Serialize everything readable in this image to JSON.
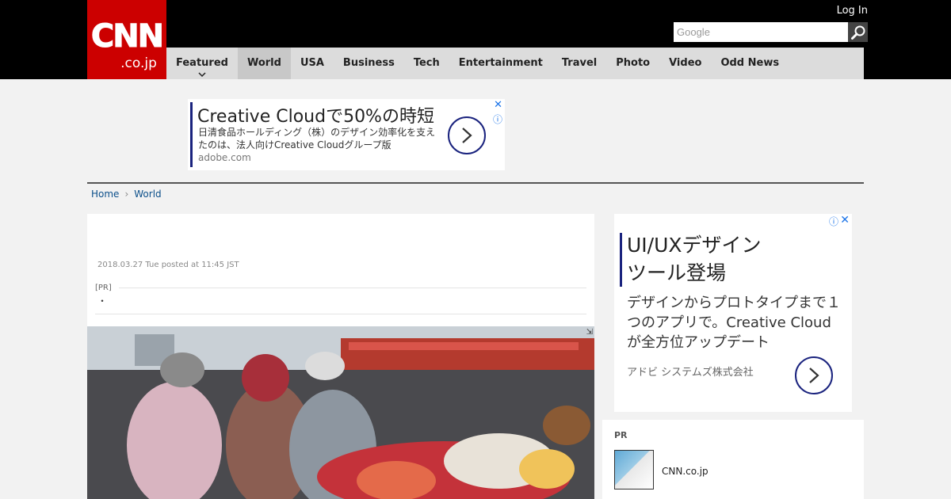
{
  "header": {
    "logo_main": "CNN",
    "logo_sub": ".co.jp",
    "login": "Log In",
    "search_placeholder": "Google"
  },
  "nav": {
    "items": [
      {
        "label": "Featured"
      },
      {
        "label": "World"
      },
      {
        "label": "USA"
      },
      {
        "label": "Business"
      },
      {
        "label": "Tech"
      },
      {
        "label": "Entertainment"
      },
      {
        "label": "Travel"
      },
      {
        "label": "Photo"
      },
      {
        "label": "Video"
      },
      {
        "label": "Odd News"
      }
    ],
    "active": "World"
  },
  "ad_banner": {
    "headline": "Creative Cloudで50%の時短",
    "description": "日清食品ホールディング（株）のデザイン効率化を支えたのは、法人向けCreative Cloudグループ版",
    "url": "adobe.com"
  },
  "breadcrumb": {
    "home": "Home",
    "section": "World"
  },
  "article": {
    "posted": "2018.03.27 Tue posted at 11:45 JST",
    "pr_label": "[PR]",
    "pr_text": "・"
  },
  "side_ad": {
    "headline_line1": "UI/UXデザイン",
    "headline_line2": "ツール登場",
    "description": "デザインからプロトタイプまで１つのアプリで。Creative Cloudが全方位アップデート",
    "advertiser": "アドビ システムズ株式会社"
  },
  "pr_box": {
    "title": "PR",
    "item_name": "CNN.co.jp"
  },
  "colors": {
    "brand": "#cc0000",
    "ad_accent": "#1a237e",
    "link": "#0b4f8a"
  }
}
